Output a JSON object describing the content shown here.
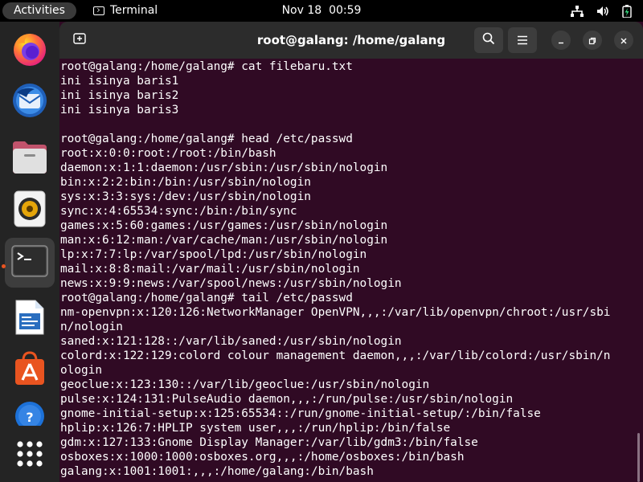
{
  "topbar": {
    "activities_label": "Activities",
    "app_name": "Terminal",
    "date": "Nov 18",
    "time": "00:59",
    "tray_icons": [
      "network-icon",
      "volume-icon",
      "battery-icon"
    ]
  },
  "dock": {
    "items": [
      {
        "name": "Firefox",
        "icon": "firefox-icon"
      },
      {
        "name": "Thunderbird",
        "icon": "thunderbird-icon"
      },
      {
        "name": "Files",
        "icon": "files-icon"
      },
      {
        "name": "Rhythmbox",
        "icon": "rhythmbox-icon"
      },
      {
        "name": "Terminal",
        "icon": "terminal-icon",
        "active": true
      },
      {
        "name": "LibreOffice Writer",
        "icon": "writer-icon"
      },
      {
        "name": "Ubuntu Software",
        "icon": "software-icon"
      },
      {
        "name": "Help",
        "icon": "help-icon"
      },
      {
        "name": "Show Applications",
        "icon": "app-grid-icon"
      }
    ]
  },
  "window": {
    "title": "root@galang: /home/galang"
  },
  "terminal": {
    "lines": [
      "root@galang:/home/galang# cat filebaru.txt",
      "ini isinya baris1",
      "ini isinya baris2",
      "ini isinya baris3",
      "",
      "root@galang:/home/galang# head /etc/passwd",
      "root:x:0:0:root:/root:/bin/bash",
      "daemon:x:1:1:daemon:/usr/sbin:/usr/sbin/nologin",
      "bin:x:2:2:bin:/bin:/usr/sbin/nologin",
      "sys:x:3:3:sys:/dev:/usr/sbin/nologin",
      "sync:x:4:65534:sync:/bin:/bin/sync",
      "games:x:5:60:games:/usr/games:/usr/sbin/nologin",
      "man:x:6:12:man:/var/cache/man:/usr/sbin/nologin",
      "lp:x:7:7:lp:/var/spool/lpd:/usr/sbin/nologin",
      "mail:x:8:8:mail:/var/mail:/usr/sbin/nologin",
      "news:x:9:9:news:/var/spool/news:/usr/sbin/nologin",
      "root@galang:/home/galang# tail /etc/passwd",
      "nm-openvpn:x:120:126:NetworkManager OpenVPN,,,:/var/lib/openvpn/chroot:/usr/sbi",
      "n/nologin",
      "saned:x:121:128::/var/lib/saned:/usr/sbin/nologin",
      "colord:x:122:129:colord colour management daemon,,,:/var/lib/colord:/usr/sbin/n",
      "ologin",
      "geoclue:x:123:130::/var/lib/geoclue:/usr/sbin/nologin",
      "pulse:x:124:131:PulseAudio daemon,,,:/run/pulse:/usr/sbin/nologin",
      "gnome-initial-setup:x:125:65534::/run/gnome-initial-setup/:/bin/false",
      "hplip:x:126:7:HPLIP system user,,,:/run/hplip:/bin/false",
      "gdm:x:127:133:Gnome Display Manager:/var/lib/gdm3:/bin/false",
      "osboxes:x:1000:1000:osboxes.org,,,:/home/osboxes:/bin/bash",
      "galang:x:1001:1001:,,,:/home/galang:/bin/bash"
    ]
  },
  "colors": {
    "terminal_bg": "#300a24",
    "terminal_fg": "#ffffff",
    "accent": "#e95420",
    "topbar_bg": "#000000",
    "dock_bg": "#242424",
    "headerbar_bg": "#2c2c2c"
  }
}
